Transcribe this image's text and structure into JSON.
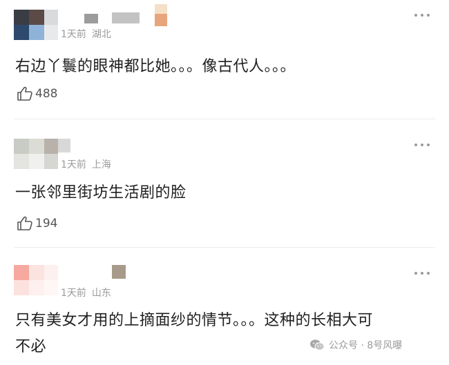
{
  "comments": [
    {
      "time": "1天前",
      "location": "湖北",
      "text": "右边丫鬟的眼神都比她。。。像古代人。。。",
      "likes": "488"
    },
    {
      "time": "1天前",
      "location": "上海",
      "text": "一张邻里街坊生活剧的脸",
      "likes": "194"
    },
    {
      "time": "1天前",
      "location": "山东",
      "text_line1": "只有美女才用的上摘面纱的情节。。。这种的长相大可",
      "text_line2": "不必"
    }
  ],
  "icons": {
    "more": "more-dots-icon",
    "like": "thumbs-up-icon",
    "watermark": "wechat-icon"
  },
  "watermark": {
    "label": "公众号 · 8号风曝"
  }
}
